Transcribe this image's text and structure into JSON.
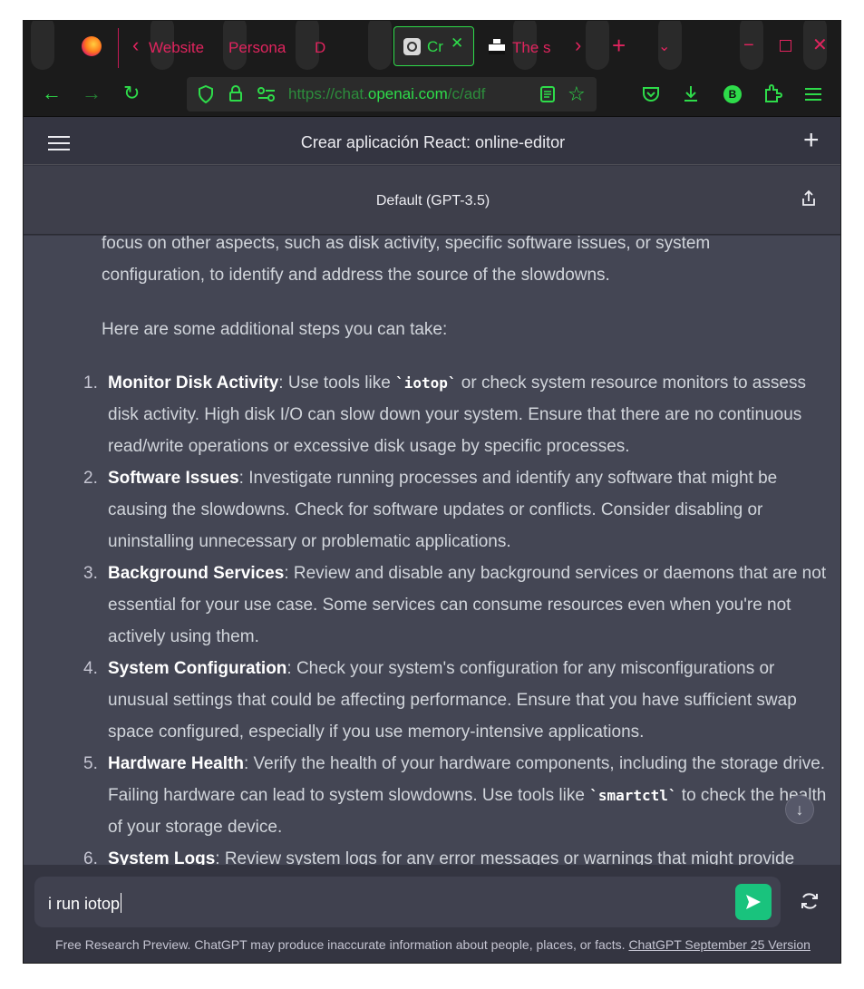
{
  "browser": {
    "tabs": [
      {
        "label": "Website"
      },
      {
        "label": "Persona"
      },
      {
        "label": "D"
      },
      {
        "label": "Cr",
        "active": true
      },
      {
        "label": "The s"
      }
    ],
    "url_prefix": "https://chat.",
    "url_host": "openai.com",
    "url_path": "/c/adf",
    "profile_badge": "B"
  },
  "app": {
    "title": "Crear aplicación React: online-editor",
    "model": "Default (GPT-3.5)"
  },
  "message": {
    "intro_line1": "focus on other aspects, such as disk activity, specific software issues, or system",
    "intro_line2": "configuration, to identify and address the source of the slowdowns.",
    "steps_intro": "Here are some additional steps you can take:",
    "items": [
      {
        "num": "1.",
        "title": "Monitor Disk Activity",
        "pre": ": Use tools like ",
        "code": "`iotop`",
        "post": " or check system resource monitors to assess disk activity. High disk I/O can slow down your system. Ensure that there are no continuous read/write operations or excessive disk usage by specific processes."
      },
      {
        "num": "2.",
        "title": "Software Issues",
        "pre": ": Investigate running processes and identify any software that might be causing the slowdowns. Check for software updates or conflicts. Consider disabling or uninstalling unnecessary or problematic applications.",
        "code": "",
        "post": ""
      },
      {
        "num": "3.",
        "title": "Background Services",
        "pre": ": Review and disable any background services or daemons that are not essential for your use case. Some services can consume resources even when you're not actively using them.",
        "code": "",
        "post": ""
      },
      {
        "num": "4.",
        "title": "System Configuration",
        "pre": ": Check your system's configuration for any misconfigurations or unusual settings that could be affecting performance. Ensure that you have sufficient swap space configured, especially if you use memory-intensive applications.",
        "code": "",
        "post": ""
      },
      {
        "num": "5.",
        "title": "Hardware Health",
        "pre": ": Verify the health of your hardware components, including the storage drive. Failing hardware can lead to system slowdowns. Use tools like ",
        "code": "`smartctl`",
        "post": " to check the health of your storage device."
      },
      {
        "num": "6.",
        "title": "System Logs",
        "pre": ": Review system logs for any error messages or warnings that might provide",
        "code": "",
        "post": ""
      }
    ]
  },
  "composer": {
    "value": "i run iotop"
  },
  "footer": {
    "text": "Free Research Preview. ChatGPT may produce inaccurate information about people, places, or facts. ",
    "link": "ChatGPT September 25 Version"
  },
  "colors": {
    "accent_green": "#2edc4a",
    "tab_pink": "#e0245e",
    "send_button": "#19c37d",
    "chat_bg": "#444654"
  }
}
